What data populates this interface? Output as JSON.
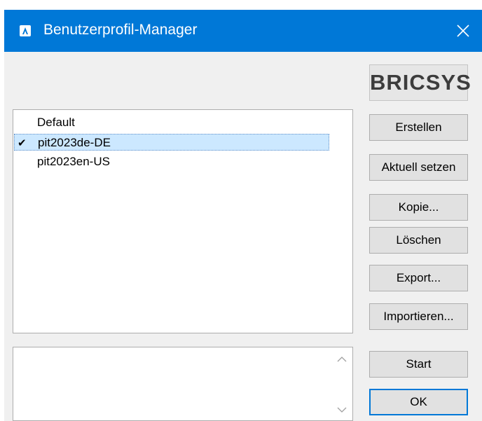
{
  "window": {
    "title": "Benutzerprofil-Manager",
    "accent_color": "#0078d7",
    "app_icon": "bricscad-app-icon",
    "close_icon": "close-icon"
  },
  "logo": {
    "text": "BRICSYS"
  },
  "profiles": {
    "items": [
      {
        "label": "Default",
        "checked": false,
        "selected": false
      },
      {
        "label": "pit2023de-DE",
        "checked": true,
        "selected": true
      },
      {
        "label": "pit2023en-US",
        "checked": false,
        "selected": false
      }
    ],
    "check_mark": "✔"
  },
  "buttons": {
    "create": "Erstellen",
    "set_current": "Aktuell setzen",
    "copy": "Kopie...",
    "delete": "Löschen",
    "export": "Export...",
    "import": "Importieren...",
    "start": "Start",
    "ok": "OK"
  },
  "description": {
    "text": ""
  }
}
